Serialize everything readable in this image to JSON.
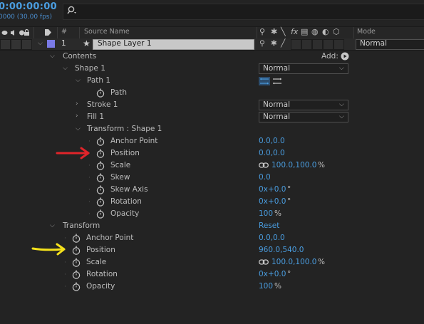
{
  "timeline": {
    "timecode": "0:00:00:00",
    "fps": "0000 (30.00 fps)"
  },
  "header": {
    "hash": "#",
    "source_name": "Source Name",
    "mode": "Mode"
  },
  "layer": {
    "number": "1",
    "name": "Shape Layer 1",
    "mode": "Normal"
  },
  "contents": {
    "label": "Contents",
    "add_label": "Add:",
    "shape_group": {
      "label": "Shape 1",
      "mode": "Normal",
      "path_group": {
        "label": "Path 1",
        "path_label": "Path"
      },
      "stroke": {
        "label": "Stroke 1",
        "mode": "Normal"
      },
      "fill": {
        "label": "Fill 1",
        "mode": "Normal"
      },
      "transform": {
        "label": "Transform : Shape 1",
        "properties": [
          {
            "label": "Anchor Point",
            "value": "0.0,0.0"
          },
          {
            "label": "Position",
            "value": "0.0,0.0"
          },
          {
            "label": "Scale",
            "value": "100.0,100.0",
            "unit": "%"
          },
          {
            "label": "Skew",
            "value": "0.0"
          },
          {
            "label": "Skew Axis",
            "value": "0x+0.0",
            "unit": "°"
          },
          {
            "label": "Rotation",
            "value": "0x+0.0",
            "unit": "°"
          },
          {
            "label": "Opacity",
            "value": "100",
            "unit": "%"
          }
        ]
      }
    }
  },
  "transform": {
    "label": "Transform",
    "reset_label": "Reset",
    "properties": [
      {
        "label": "Anchor Point",
        "value": "0.0,0.0"
      },
      {
        "label": "Position",
        "value": "960.0,540.0"
      },
      {
        "label": "Scale",
        "value": "100.0,100.0",
        "unit": "%"
      },
      {
        "label": "Rotation",
        "value": "0x+0.0",
        "unit": "°"
      },
      {
        "label": "Opacity",
        "value": "100",
        "unit": "%"
      }
    ]
  },
  "annotations": {
    "red_arrow_color": "#e0242a",
    "yellow_arrow_color": "#f5e21b"
  },
  "colors": {
    "value_blue": "#4a9de0",
    "label_purple": "#7a7ae6"
  }
}
